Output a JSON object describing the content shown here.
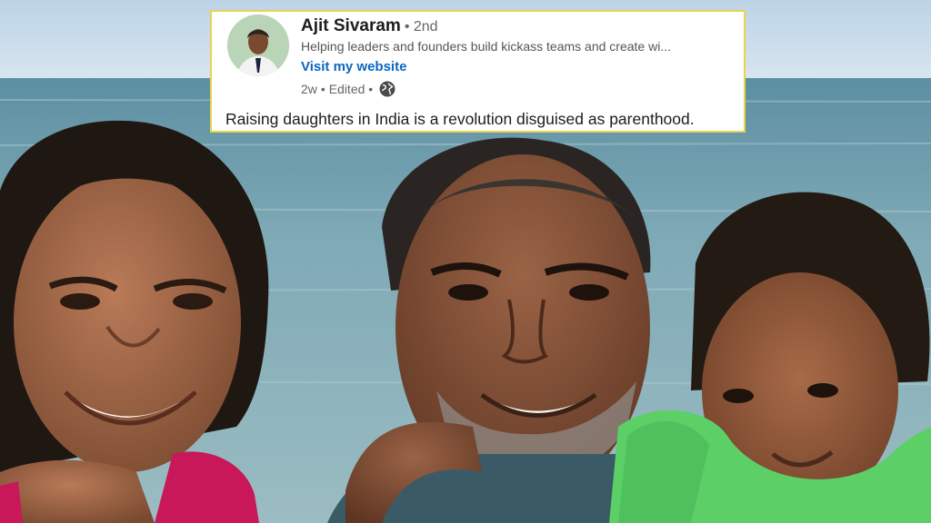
{
  "post": {
    "author_name": "Ajit Sivaram",
    "connection_degree": "• 2nd",
    "headline": "Helping leaders and founders build kickass teams and create wi...",
    "website_link": "Visit my website",
    "timestamp": "2w",
    "edited_label": "• Edited •",
    "visibility_icon": "globe-icon",
    "text": "Raising daughters in India is a revolution disguised as parenthood."
  },
  "colors": {
    "card_border": "#e8d44d",
    "link": "#0a66c2",
    "sky": "#c7dcea",
    "sea": "#7ca6b3",
    "green_shirt": "#5ccf67",
    "pink_shirt": "#c8185a"
  }
}
